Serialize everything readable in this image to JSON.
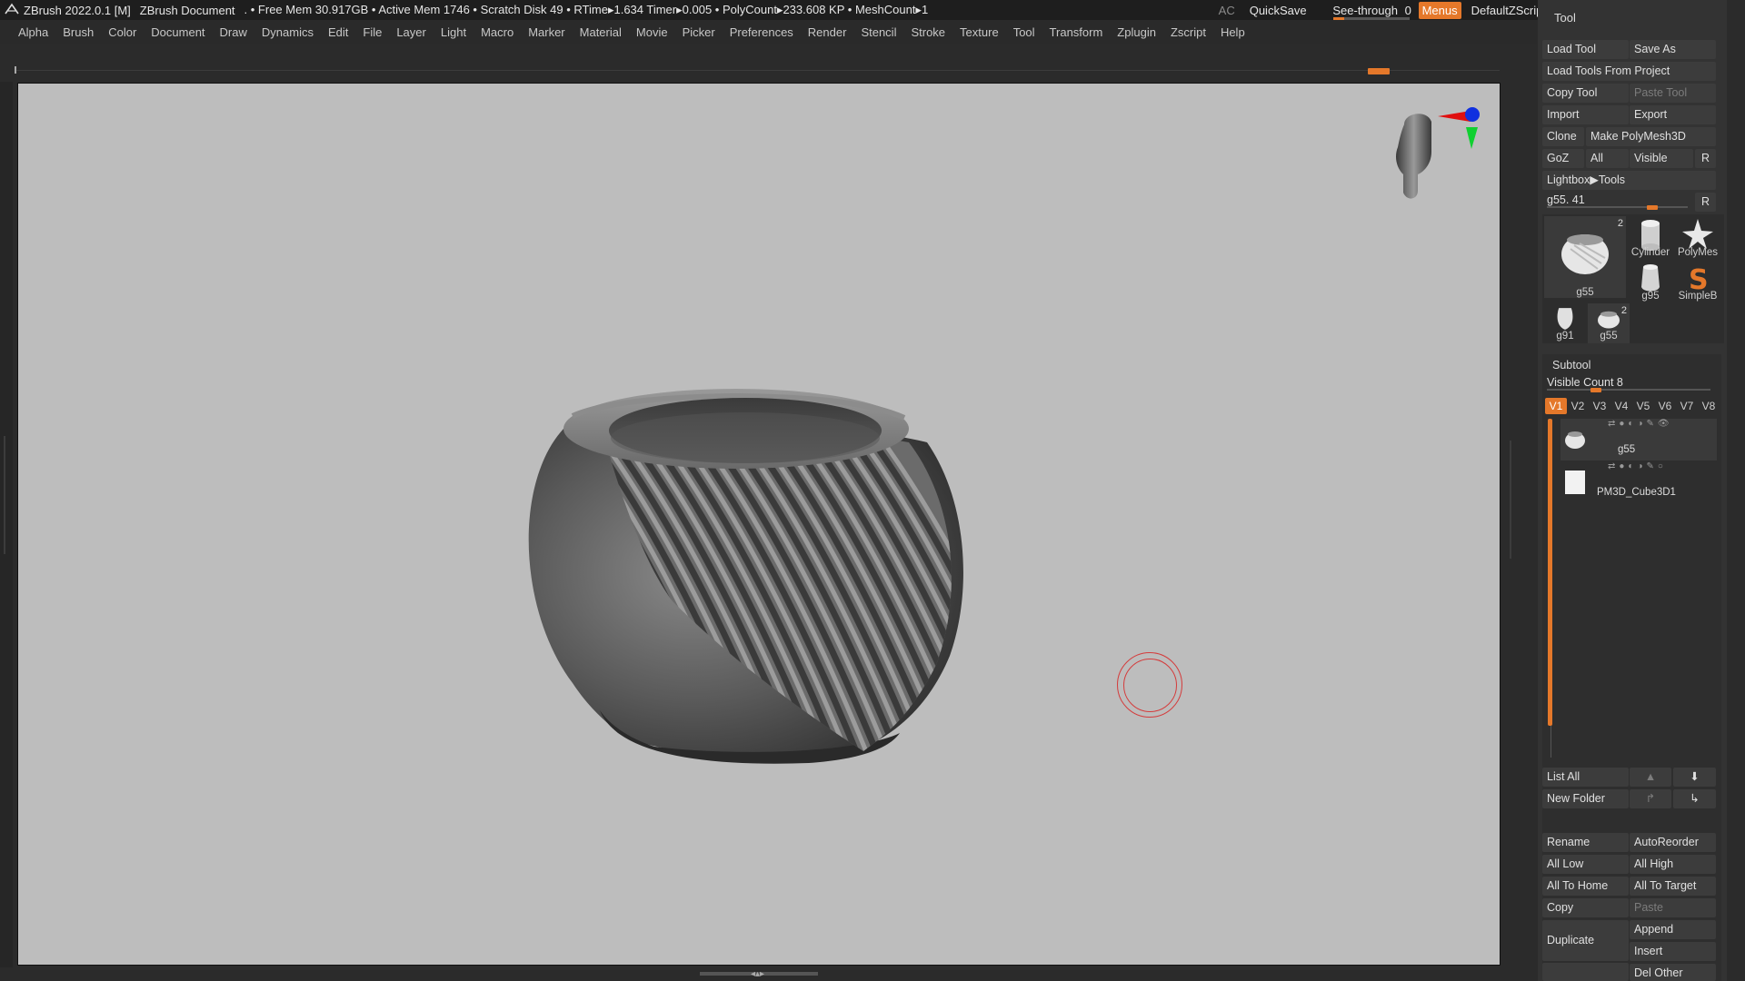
{
  "titlebar": {
    "app": "ZBrush 2022.0.1 [M]",
    "document": "ZBrush Document",
    "stats": ". • Free Mem 30.917GB • Active Mem 1746 • Scratch Disk 49 •  RTime▸1.634 Timer▸0.005 • PolyCount▸233.608 KP  • MeshCount▸1",
    "ac": "AC",
    "quicksave": "QuickSave",
    "see_through_label": "See-through",
    "see_through_value": "0",
    "see_through_level": 0.0,
    "menus": "Menus",
    "script": "DefaultZScript"
  },
  "menubar": [
    "Alpha",
    "Brush",
    "Color",
    "Document",
    "Draw",
    "Dynamics",
    "Edit",
    "File",
    "Layer",
    "Light",
    "Macro",
    "Marker",
    "Material",
    "Movie",
    "Picker",
    "Preferences",
    "Render",
    "Stencil",
    "Stroke",
    "Texture",
    "Tool",
    "Transform",
    "Zplugin",
    "Zscript",
    "Help"
  ],
  "colors": {
    "accent": "#e5782a",
    "canvas": "#bdbdbd",
    "panel": "#333333",
    "cursor": "#d43c3c"
  },
  "tool_panel": {
    "title": "Tool",
    "load_tool": "Load Tool",
    "save_as": "Save As",
    "load_from_project": "Load Tools From Project",
    "copy_tool": "Copy Tool",
    "paste_tool": "Paste Tool",
    "import": "Import",
    "export": "Export",
    "clone": "Clone",
    "make_polymesh": "Make PolyMesh3D",
    "goz": "GoZ",
    "all": "All",
    "visible": "Visible",
    "r": "R",
    "lightbox": "Lightbox▶Tools",
    "slider_label": "g55. 41",
    "slider_value": 0.75,
    "thumbs": [
      {
        "name": "g55",
        "count": "2"
      },
      {
        "name": "Cylinder",
        "count": ""
      },
      {
        "name": "PolyMes",
        "count": ""
      },
      {
        "name": "g95",
        "count": ""
      },
      {
        "name": "SimpleB",
        "count": ""
      },
      {
        "name": "g91",
        "count": ""
      },
      {
        "name": "g55",
        "count": "2"
      }
    ]
  },
  "subtool": {
    "title": "Subtool",
    "visible_count_label": "Visible Count",
    "visible_count": "8",
    "visible_count_level": 0.3,
    "tabs": [
      "V1",
      "V2",
      "V3",
      "V4",
      "V5",
      "V6",
      "V7",
      "V8"
    ],
    "items": [
      {
        "name": "g55"
      },
      {
        "name": "PM3D_Cube3D1"
      }
    ],
    "list_all": "List All",
    "new_folder": "New Folder",
    "rename": "Rename",
    "autoreorder": "AutoReorder",
    "all_low": "All Low",
    "all_high": "All High",
    "all_to_home": "All To Home",
    "all_to_target": "All To Target",
    "copy": "Copy",
    "paste": "Paste",
    "duplicate": "Duplicate",
    "append": "Append",
    "insert": "Insert",
    "del_other": "Del Other"
  }
}
